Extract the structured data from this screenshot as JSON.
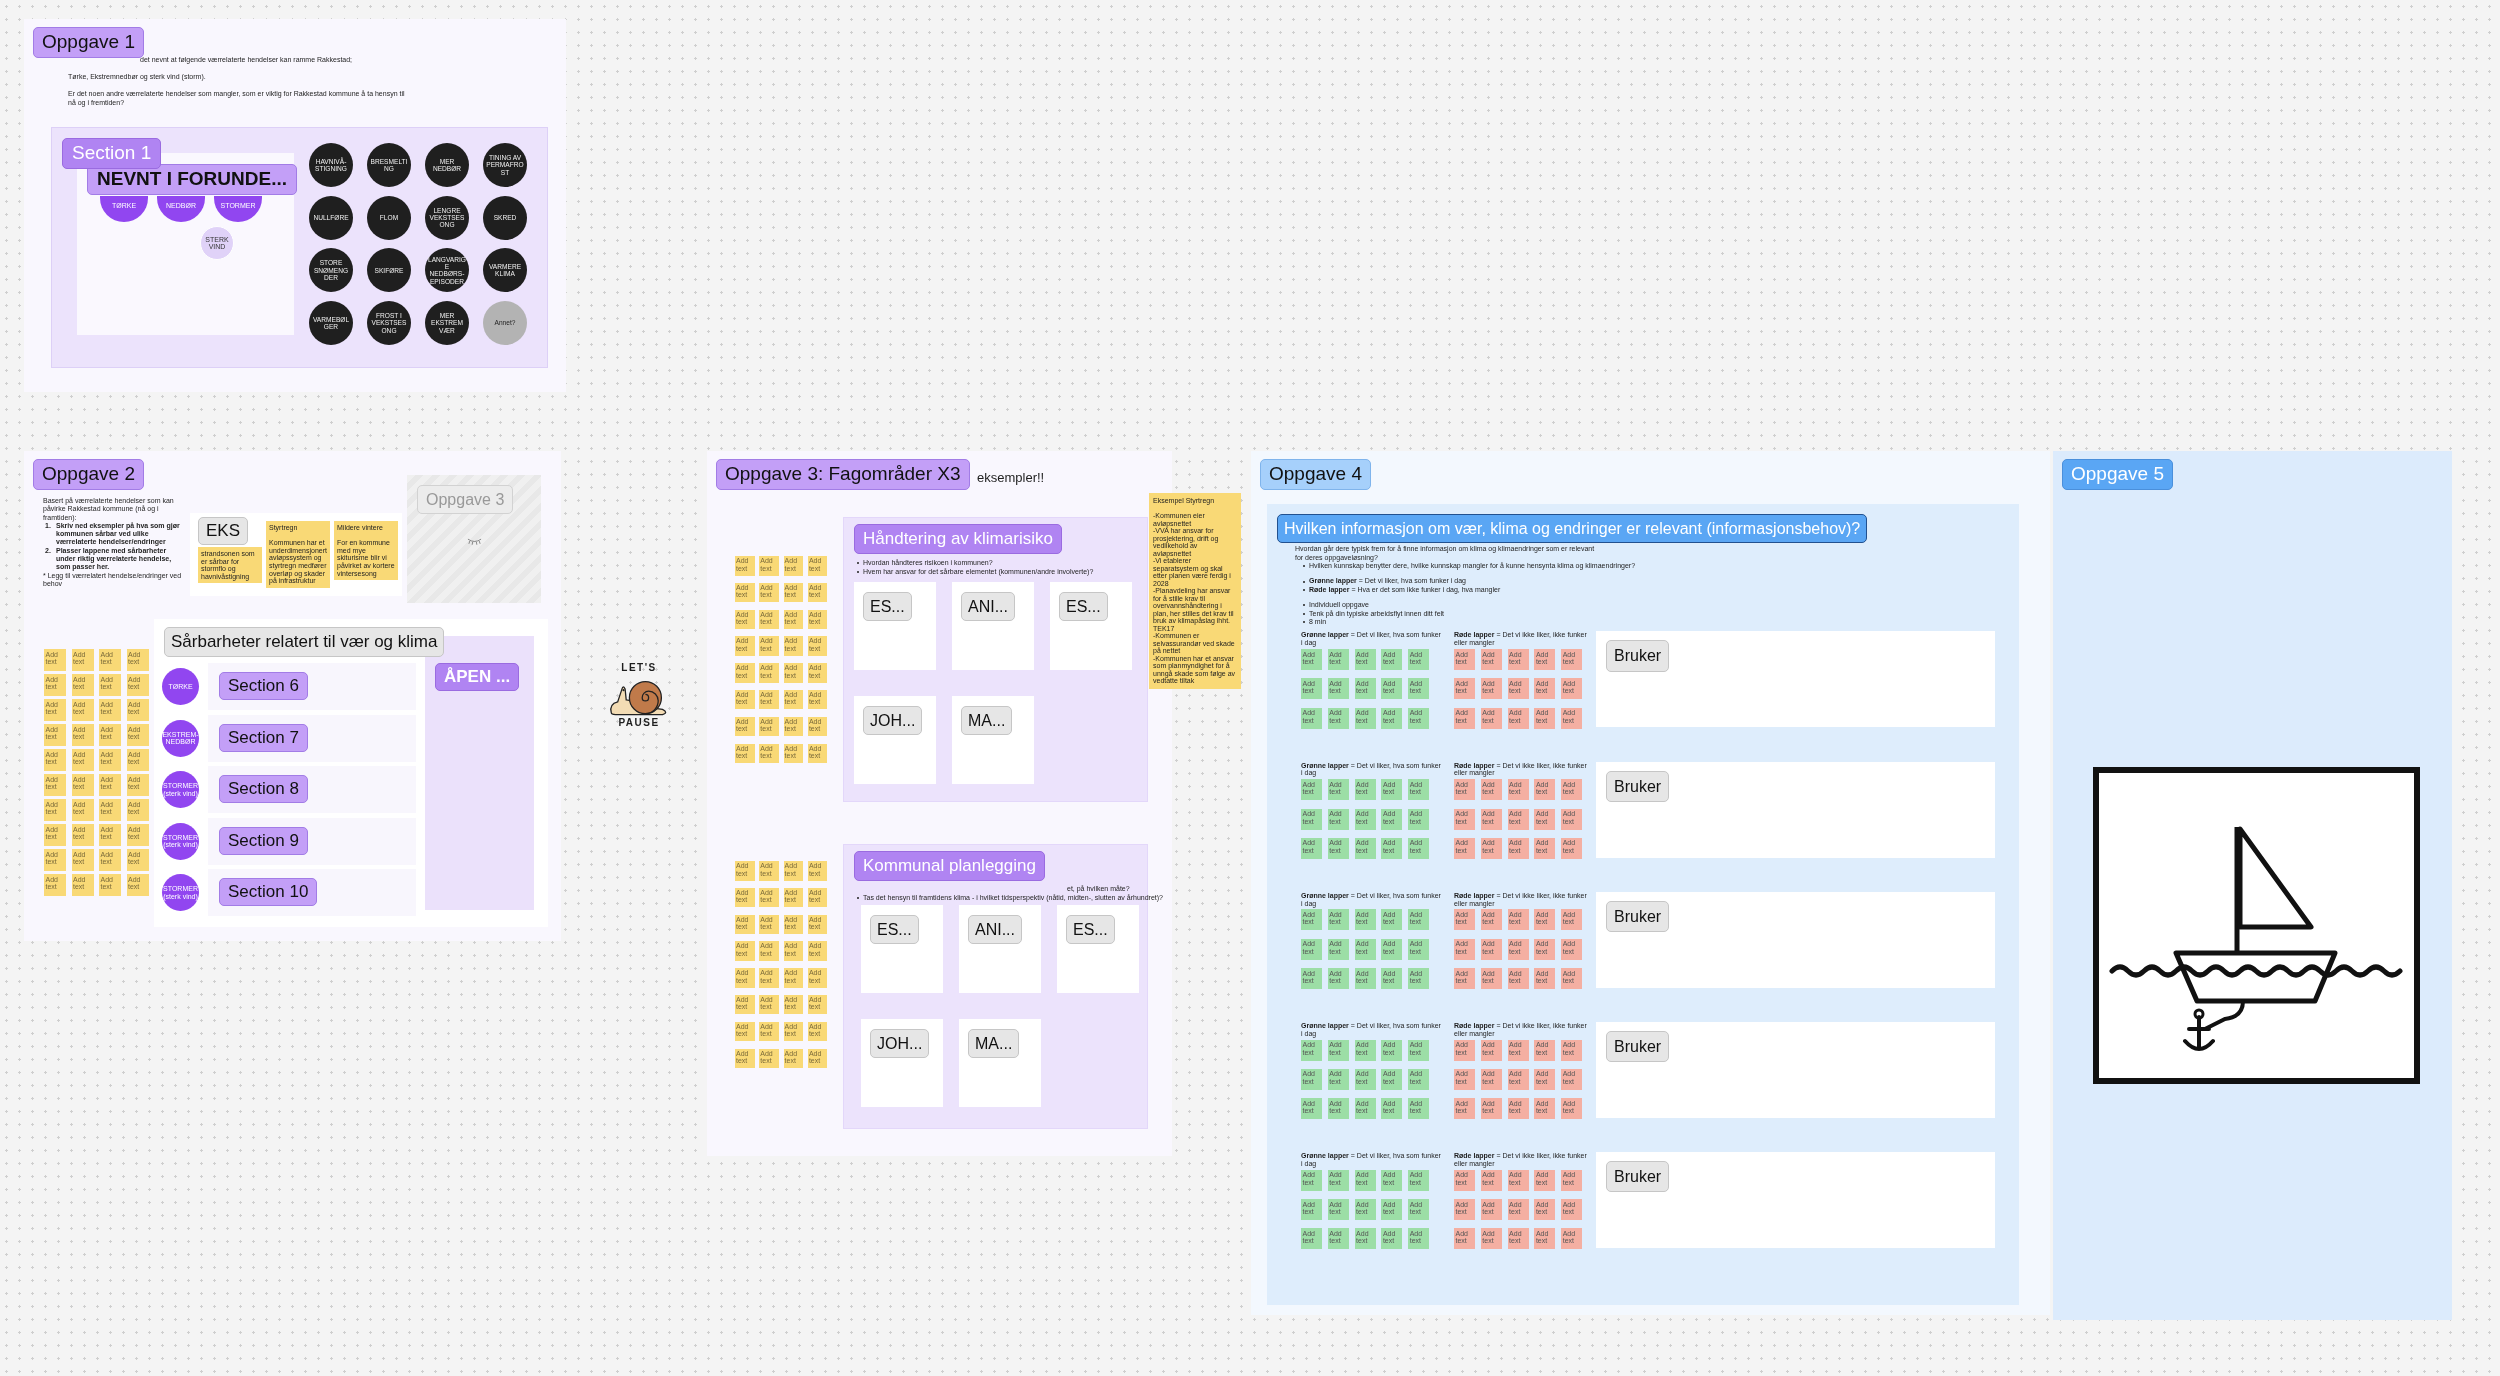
{
  "oppgave_1": {
    "label": "Oppgave 1",
    "intro": [
      "det nevnt at følgende værrelaterte hendelser  kan ramme Rakkestad;",
      "Tørke, Ekstremnedbør og sterk vind (storm).",
      "Er det noen andre værrelaterte hendelser som mangler, som er viktig for Rakkestad kommune å ta hensyn til nå og i fremtiden?"
    ],
    "section": {
      "label": "Section 1",
      "mentioned_label": "NEVNT I FORUNDE...",
      "mentioned": [
        {
          "text": "TØRKE",
          "kind": "large"
        },
        {
          "text": "NEDBØR",
          "kind": "large"
        },
        {
          "text": "STORMER",
          "kind": "large"
        },
        {
          "text": "STERK VIND",
          "kind": "small"
        }
      ],
      "events": [
        {
          "text": "HAVNIVÅ-STIGNING",
          "kind": "dark"
        },
        {
          "text": "BRESMELTING",
          "kind": "dark"
        },
        {
          "text": "MER NEDBØR",
          "kind": "dark"
        },
        {
          "text": "TINING AV PERMAFROST",
          "kind": "dark"
        },
        {
          "text": "NULLFØRE",
          "kind": "dark"
        },
        {
          "text": "FLOM",
          "kind": "dark"
        },
        {
          "text": "LENGRE VEKSTSESONG",
          "kind": "dark"
        },
        {
          "text": "SKRED",
          "kind": "dark"
        },
        {
          "text": "STORE SNØMENGDER",
          "kind": "dark"
        },
        {
          "text": "SKIFØRE",
          "kind": "dark"
        },
        {
          "text": "LANGVARIGE NEDBØRS-EPISODER",
          "kind": "dark"
        },
        {
          "text": "VARMERE KLIMA",
          "kind": "dark"
        },
        {
          "text": "VARMEBØLGER",
          "kind": "dark"
        },
        {
          "text": "FROST I VEKSTSESONG",
          "kind": "dark"
        },
        {
          "text": "MER EKSTREM VÆR",
          "kind": "dark"
        },
        {
          "text": "Annet?",
          "kind": "open"
        }
      ]
    }
  },
  "oppgave_2": {
    "label": "Oppgave 2",
    "intro": "Basert på værrelaterte hendelser som kan påvirke Rakkestad kommune (nå og i framtiden):",
    "steps": [
      {
        "number": "1.",
        "text": "Skriv ned eksempler på hva som gjør kommunen sårbar ved ulike værrelaterte hendelser/endringer"
      },
      {
        "number": "2.",
        "text": "Plasser lappene med sårbarheter under riktig værrelaterte hendelse, som passer her."
      }
    ],
    "note": "* Legg til værrelatert hendelse/endringer ved behov",
    "example": {
      "label": "EKS",
      "notes": [
        "strandsonen som er sårbar for stormflo og havnivåstigning",
        "Styrtregn\n\nKommunen har et underdimensjonert avløpssystem og styrtregn medfører overløp og skader på infrastruktur",
        "Mildere vintere\n\nFor en kommune med mye skiturisme blir vi påvirket av kortere vintersesong"
      ]
    },
    "hidden_frame": {
      "label": "Oppgave 3"
    },
    "sticky_notes": [
      "Add text",
      "Add text",
      "Add text",
      "Add text",
      "Add text",
      "Add text",
      "Add text",
      "Add text",
      "Add text",
      "Add text",
      "Add text",
      "Add text",
      "Add text",
      "Add text",
      "Add text",
      "Add text",
      "Add text",
      "Add text",
      "Add text",
      "Add text",
      "Add text",
      "Add text",
      "Add text",
      "Add text",
      "Add text",
      "Add text",
      "Add text",
      "Add text",
      "Add text",
      "Add text",
      "Add text",
      "Add text",
      "Add text",
      "Add text",
      "Add text",
      "Add text",
      "Add text",
      "Add text",
      "Add text",
      "Add text"
    ],
    "board": {
      "title": "Sårbarheter relatert til vær og klima",
      "open_label": "ÅPEN ...",
      "rows": [
        {
          "event": "TØRKE",
          "section": "Section 6"
        },
        {
          "event": "EKSTREM-NEDBØR",
          "section": "Section 7"
        },
        {
          "event": "STORMER (sterk vind)",
          "section": "Section 8"
        },
        {
          "event": "STORMER (sterk vind)",
          "section": "Section 9"
        },
        {
          "event": "STORMER (sterk vind)",
          "section": "Section 10"
        }
      ]
    }
  },
  "sticker": {
    "top": "LET'S",
    "bottom": "PAUSE"
  },
  "oppgave_3": {
    "label": "Oppgave 3: Fagområder X3",
    "aside": "eksempler!!",
    "example_note": "Eksempel Styrtregn\n\n-Kommunen eier avløpsnettet\n-VVA har ansvar for prosjektering, drift og vedlikehold av avløpsnettet\n-Vi etablerer separatsystem og skal etter planen være ferdig i 2028\n-Planavdeling har ansvar for å stille krav til overvannshåndtering i plan, her stilles det krav til bruk av klimapåslag ihht. TEK17\n-Kommunen er selvassurandør ved skade på nettet\n-Kommunen har et ansvar som planmyndighet for å unngå skade som følge av vedtatte tiltak",
    "groups": [
      {
        "title": "Håndtering av klimarisiko",
        "questions": [
          {
            "text": "Hvordan håndteres risikoen i kommunen?",
            "bullet": true
          },
          {
            "text": "Hvem har ansvar for det sårbare elementet (kommunen/andre involverte)?",
            "bullet": true
          }
        ],
        "cards": [
          "ES...",
          "ANI...",
          "ES...",
          "JOH...",
          "MA..."
        ],
        "sticky_notes": [
          "Add text",
          "Add text",
          "Add text",
          "Add text",
          "Add text",
          "Add text",
          "Add text",
          "Add text",
          "Add text",
          "Add text",
          "Add text",
          "Add text",
          "Add text",
          "Add text",
          "Add text",
          "Add text",
          "Add text",
          "Add text",
          "Add text",
          "Add text",
          "Add text",
          "Add text",
          "Add text",
          "Add text",
          "Add text",
          "Add text",
          "Add text",
          "Add text",
          "Add text",
          "Add text",
          "Add text",
          "Add text"
        ]
      },
      {
        "title": "Kommunal planlegging",
        "questions": [
          {
            "text": "et, på hvilken måte?",
            "bullet": false
          },
          {
            "text": "Tas det hensyn til framtidens klima - i hvilket tidsperspektiv (nåtid, midten-, slutten av århundret)?",
            "bullet": true
          }
        ],
        "cards": [
          "ES...",
          "ANI...",
          "ES...",
          "JOH...",
          "MA..."
        ],
        "sticky_notes": [
          "Add text",
          "Add text",
          "Add text",
          "Add text",
          "Add text",
          "Add text",
          "Add text",
          "Add text",
          "Add text",
          "Add text",
          "Add text",
          "Add text",
          "Add text",
          "Add text",
          "Add text",
          "Add text",
          "Add text",
          "Add text",
          "Add text",
          "Add text",
          "Add text",
          "Add text",
          "Add text",
          "Add text",
          "Add text",
          "Add text",
          "Add text",
          "Add text",
          "Add text",
          "Add text",
          "Add text",
          "Add text"
        ]
      }
    ]
  },
  "oppgave_4": {
    "label": "Oppgave 4",
    "title": "Hvilken informasjon om vær, klima og endringer er relevant (informasjonsbehov)?",
    "intro": "Hvordan går dere typisk frem for å finne informasjon om klima og klimaendringer som er relevant for deres oppgaveløsning?",
    "bullet_groups": [
      [
        "Hvilken kunnskap benytter dere, hvilke kunnskap mangler for å kunne hensynta klima og klimaendringer?"
      ],
      [
        "**Grønne lapper** = Det vi liker, hva som funker i dag",
        "**Røde lapper** = Hva er det som ikke funker i dag, hva mangler"
      ],
      [
        "Individuell oppgave",
        "Tenk på din typiske arbeidsflyt innen ditt felt",
        "8 min"
      ]
    ],
    "rows": [
      {
        "green_label": "**Grønne lapper** = Det vi liker, hva som funker i dag",
        "green_notes": [
          "Add text",
          "Add text",
          "Add text",
          "Add text",
          "Add text",
          "Add text",
          "Add text",
          "Add text",
          "Add text",
          "Add text",
          "Add text",
          "Add text",
          "Add text",
          "Add text",
          "Add text"
        ],
        "red_label": "**Røde lapper** = Det vi ikke liker, ikke funker eller mangler",
        "red_notes": [
          "Add text",
          "Add text",
          "Add text",
          "Add text",
          "Add text",
          "Add text",
          "Add text",
          "Add text",
          "Add text",
          "Add text",
          "Add text",
          "Add text",
          "Add text",
          "Add text",
          "Add text"
        ],
        "card_label": "Bruker"
      },
      {
        "green_label": "**Grønne lapper** = Det vi liker, hva som funker i dag",
        "green_notes": [
          "Add text",
          "Add text",
          "Add text",
          "Add text",
          "Add text",
          "Add text",
          "Add text",
          "Add text",
          "Add text",
          "Add text",
          "Add text",
          "Add text",
          "Add text",
          "Add text",
          "Add text"
        ],
        "red_label": "**Røde lapper** = Det vi ikke liker, ikke funker eller mangler",
        "red_notes": [
          "Add text",
          "Add text",
          "Add text",
          "Add text",
          "Add text",
          "Add text",
          "Add text",
          "Add text",
          "Add text",
          "Add text",
          "Add text",
          "Add text",
          "Add text",
          "Add text",
          "Add text"
        ],
        "card_label": "Bruker"
      },
      {
        "green_label": "**Grønne lapper** = Det vi liker, hva som funker i dag",
        "green_notes": [
          "Add text",
          "Add text",
          "Add text",
          "Add text",
          "Add text",
          "Add text",
          "Add text",
          "Add text",
          "Add text",
          "Add text",
          "Add text",
          "Add text",
          "Add text",
          "Add text",
          "Add text"
        ],
        "red_label": "**Røde lapper** = Det vi ikke liker, ikke funker eller mangler",
        "red_notes": [
          "Add text",
          "Add text",
          "Add text",
          "Add text",
          "Add text",
          "Add text",
          "Add text",
          "Add text",
          "Add text",
          "Add text",
          "Add text",
          "Add text",
          "Add text",
          "Add text",
          "Add text"
        ],
        "card_label": "Bruker"
      },
      {
        "green_label": "**Grønne lapper** = Det vi liker, hva som funker i dag",
        "green_notes": [
          "Add text",
          "Add text",
          "Add text",
          "Add text",
          "Add text",
          "Add text",
          "Add text",
          "Add text",
          "Add text",
          "Add text",
          "Add text",
          "Add text",
          "Add text",
          "Add text",
          "Add text"
        ],
        "red_label": "**Røde lapper** = Det vi ikke liker, ikke funker eller mangler",
        "red_notes": [
          "Add text",
          "Add text",
          "Add text",
          "Add text",
          "Add text",
          "Add text",
          "Add text",
          "Add text",
          "Add text",
          "Add text",
          "Add text",
          "Add text",
          "Add text",
          "Add text",
          "Add text"
        ],
        "card_label": "Bruker"
      },
      {
        "green_label": "**Grønne lapper** = Det vi liker, hva som funker i dag",
        "green_notes": [
          "Add text",
          "Add text",
          "Add text",
          "Add text",
          "Add text",
          "Add text",
          "Add text",
          "Add text",
          "Add text",
          "Add text",
          "Add text",
          "Add text",
          "Add text",
          "Add text",
          "Add text"
        ],
        "red_label": "**Røde lapper** = Det vi ikke liker, ikke funker eller mangler",
        "red_notes": [
          "Add text",
          "Add text",
          "Add text",
          "Add text",
          "Add text",
          "Add text",
          "Add text",
          "Add text",
          "Add text",
          "Add text",
          "Add text",
          "Add text",
          "Add text",
          "Add text",
          "Add text"
        ],
        "card_label": "Bruker"
      }
    ]
  },
  "oppgave_5": {
    "label": "Oppgave 5"
  }
}
